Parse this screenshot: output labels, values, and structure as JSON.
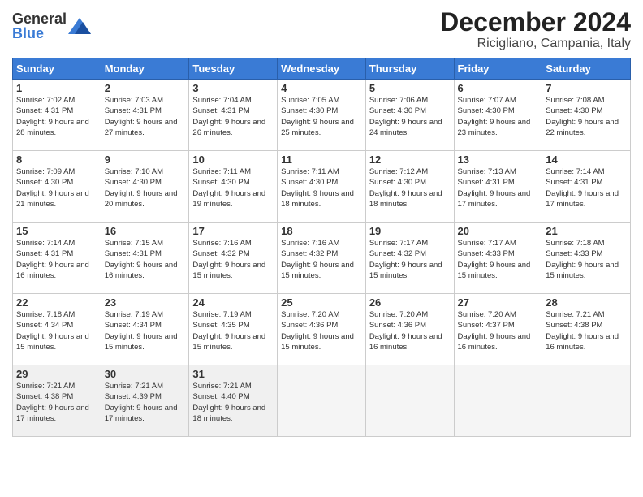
{
  "header": {
    "logo_general": "General",
    "logo_blue": "Blue",
    "title": "December 2024",
    "subtitle": "Ricigliano, Campania, Italy"
  },
  "calendar": {
    "days_of_week": [
      "Sunday",
      "Monday",
      "Tuesday",
      "Wednesday",
      "Thursday",
      "Friday",
      "Saturday"
    ],
    "weeks": [
      [
        {
          "day": "1",
          "info": "Sunrise: 7:02 AM\nSunset: 4:31 PM\nDaylight: 9 hours and 28 minutes."
        },
        {
          "day": "2",
          "info": "Sunrise: 7:03 AM\nSunset: 4:31 PM\nDaylight: 9 hours and 27 minutes."
        },
        {
          "day": "3",
          "info": "Sunrise: 7:04 AM\nSunset: 4:31 PM\nDaylight: 9 hours and 26 minutes."
        },
        {
          "day": "4",
          "info": "Sunrise: 7:05 AM\nSunset: 4:30 PM\nDaylight: 9 hours and 25 minutes."
        },
        {
          "day": "5",
          "info": "Sunrise: 7:06 AM\nSunset: 4:30 PM\nDaylight: 9 hours and 24 minutes."
        },
        {
          "day": "6",
          "info": "Sunrise: 7:07 AM\nSunset: 4:30 PM\nDaylight: 9 hours and 23 minutes."
        },
        {
          "day": "7",
          "info": "Sunrise: 7:08 AM\nSunset: 4:30 PM\nDaylight: 9 hours and 22 minutes."
        }
      ],
      [
        {
          "day": "8",
          "info": "Sunrise: 7:09 AM\nSunset: 4:30 PM\nDaylight: 9 hours and 21 minutes."
        },
        {
          "day": "9",
          "info": "Sunrise: 7:10 AM\nSunset: 4:30 PM\nDaylight: 9 hours and 20 minutes."
        },
        {
          "day": "10",
          "info": "Sunrise: 7:11 AM\nSunset: 4:30 PM\nDaylight: 9 hours and 19 minutes."
        },
        {
          "day": "11",
          "info": "Sunrise: 7:11 AM\nSunset: 4:30 PM\nDaylight: 9 hours and 18 minutes."
        },
        {
          "day": "12",
          "info": "Sunrise: 7:12 AM\nSunset: 4:30 PM\nDaylight: 9 hours and 18 minutes."
        },
        {
          "day": "13",
          "info": "Sunrise: 7:13 AM\nSunset: 4:31 PM\nDaylight: 9 hours and 17 minutes."
        },
        {
          "day": "14",
          "info": "Sunrise: 7:14 AM\nSunset: 4:31 PM\nDaylight: 9 hours and 17 minutes."
        }
      ],
      [
        {
          "day": "15",
          "info": "Sunrise: 7:14 AM\nSunset: 4:31 PM\nDaylight: 9 hours and 16 minutes."
        },
        {
          "day": "16",
          "info": "Sunrise: 7:15 AM\nSunset: 4:31 PM\nDaylight: 9 hours and 16 minutes."
        },
        {
          "day": "17",
          "info": "Sunrise: 7:16 AM\nSunset: 4:32 PM\nDaylight: 9 hours and 15 minutes."
        },
        {
          "day": "18",
          "info": "Sunrise: 7:16 AM\nSunset: 4:32 PM\nDaylight: 9 hours and 15 minutes."
        },
        {
          "day": "19",
          "info": "Sunrise: 7:17 AM\nSunset: 4:32 PM\nDaylight: 9 hours and 15 minutes."
        },
        {
          "day": "20",
          "info": "Sunrise: 7:17 AM\nSunset: 4:33 PM\nDaylight: 9 hours and 15 minutes."
        },
        {
          "day": "21",
          "info": "Sunrise: 7:18 AM\nSunset: 4:33 PM\nDaylight: 9 hours and 15 minutes."
        }
      ],
      [
        {
          "day": "22",
          "info": "Sunrise: 7:18 AM\nSunset: 4:34 PM\nDaylight: 9 hours and 15 minutes."
        },
        {
          "day": "23",
          "info": "Sunrise: 7:19 AM\nSunset: 4:34 PM\nDaylight: 9 hours and 15 minutes."
        },
        {
          "day": "24",
          "info": "Sunrise: 7:19 AM\nSunset: 4:35 PM\nDaylight: 9 hours and 15 minutes."
        },
        {
          "day": "25",
          "info": "Sunrise: 7:20 AM\nSunset: 4:36 PM\nDaylight: 9 hours and 15 minutes."
        },
        {
          "day": "26",
          "info": "Sunrise: 7:20 AM\nSunset: 4:36 PM\nDaylight: 9 hours and 16 minutes."
        },
        {
          "day": "27",
          "info": "Sunrise: 7:20 AM\nSunset: 4:37 PM\nDaylight: 9 hours and 16 minutes."
        },
        {
          "day": "28",
          "info": "Sunrise: 7:21 AM\nSunset: 4:38 PM\nDaylight: 9 hours and 16 minutes."
        }
      ],
      [
        {
          "day": "29",
          "info": "Sunrise: 7:21 AM\nSunset: 4:38 PM\nDaylight: 9 hours and 17 minutes."
        },
        {
          "day": "30",
          "info": "Sunrise: 7:21 AM\nSunset: 4:39 PM\nDaylight: 9 hours and 17 minutes."
        },
        {
          "day": "31",
          "info": "Sunrise: 7:21 AM\nSunset: 4:40 PM\nDaylight: 9 hours and 18 minutes."
        },
        {
          "day": "",
          "info": ""
        },
        {
          "day": "",
          "info": ""
        },
        {
          "day": "",
          "info": ""
        },
        {
          "day": "",
          "info": ""
        }
      ]
    ]
  }
}
